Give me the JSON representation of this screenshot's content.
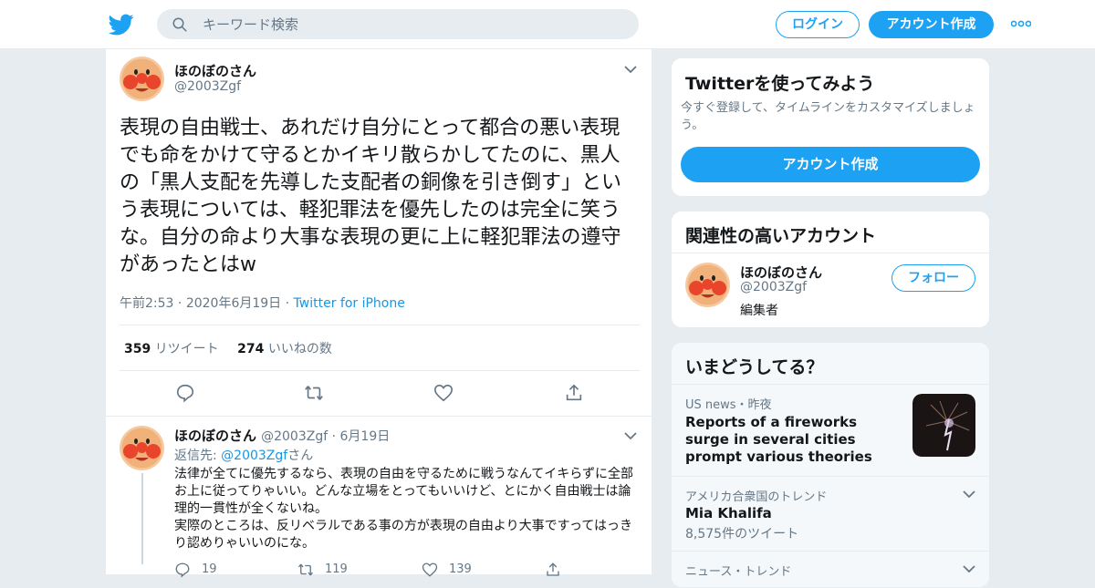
{
  "header": {
    "search_placeholder": "キーワード検索",
    "login_label": "ログイン",
    "signup_label": "アカウント作成"
  },
  "tweet": {
    "name": "ほのぼのさん",
    "handle": "@2003Zgf",
    "text": "表現の自由戦士、あれだけ自分にとって都合の悪い表現でも命をかけて守るとかイキリ散らかしてたのに、黒人の「黒人支配を先導した支配者の銅像を引き倒す」という表現については、軽犯罪法を優先したのは完全に笑うな。自分の命より大事な表現の更に上に軽犯罪法の遵守があったとはw",
    "time": "午前2:53",
    "date": "2020年6月19日",
    "source": "Twitter for iPhone",
    "retweet_count": "359",
    "retweet_label": "リツイート",
    "like_count": "274",
    "like_label": "いいねの数"
  },
  "reply": {
    "name": "ほのぼのさん",
    "handle": "@2003Zgf",
    "date": "6月19日",
    "reply_to_prefix": "返信先: ",
    "reply_to_handle": "@2003Zgf",
    "reply_to_suffix": "さん",
    "text": "法律が全てに優先するなら、表現の自由を守るために戦うなんてイキらずに全部お上に従ってりゃいい。どんな立場をとってもいいけど、とにかく自由戦士は論理的一貫性が全くないね。\n実際のところは、反リベラルである事の方が表現の自由より大事ですってはっきり認めりゃいいのにな。",
    "reply_count": "19",
    "retweet_count": "119",
    "like_count": "139"
  },
  "signup_card": {
    "title": "Twitterを使ってみよう",
    "subtitle": "今すぐ登録して、タイムラインをカスタマイズしましょう。",
    "button_label": "アカウント作成"
  },
  "related_card": {
    "title": "関連性の高いアカウント",
    "name": "ほのぼのさん",
    "handle": "@2003Zgf",
    "bio": "編集者",
    "follow_label": "フォロー"
  },
  "trends_card": {
    "title": "いまどうしてる？",
    "items": [
      {
        "context": "US news・昨夜",
        "title": "Reports of a fireworks surge in several cities prompt various theories"
      },
      {
        "context": "アメリカ合衆国のトレンド",
        "title": "Mia Khalifa",
        "count": "8,575件のツイート"
      },
      {
        "context": "ニュース・トレンド"
      }
    ]
  },
  "colors": {
    "accent": "#1da1f2",
    "link": "#1b95e0",
    "secondary_text": "#657786",
    "background": "#e6ecf0"
  }
}
